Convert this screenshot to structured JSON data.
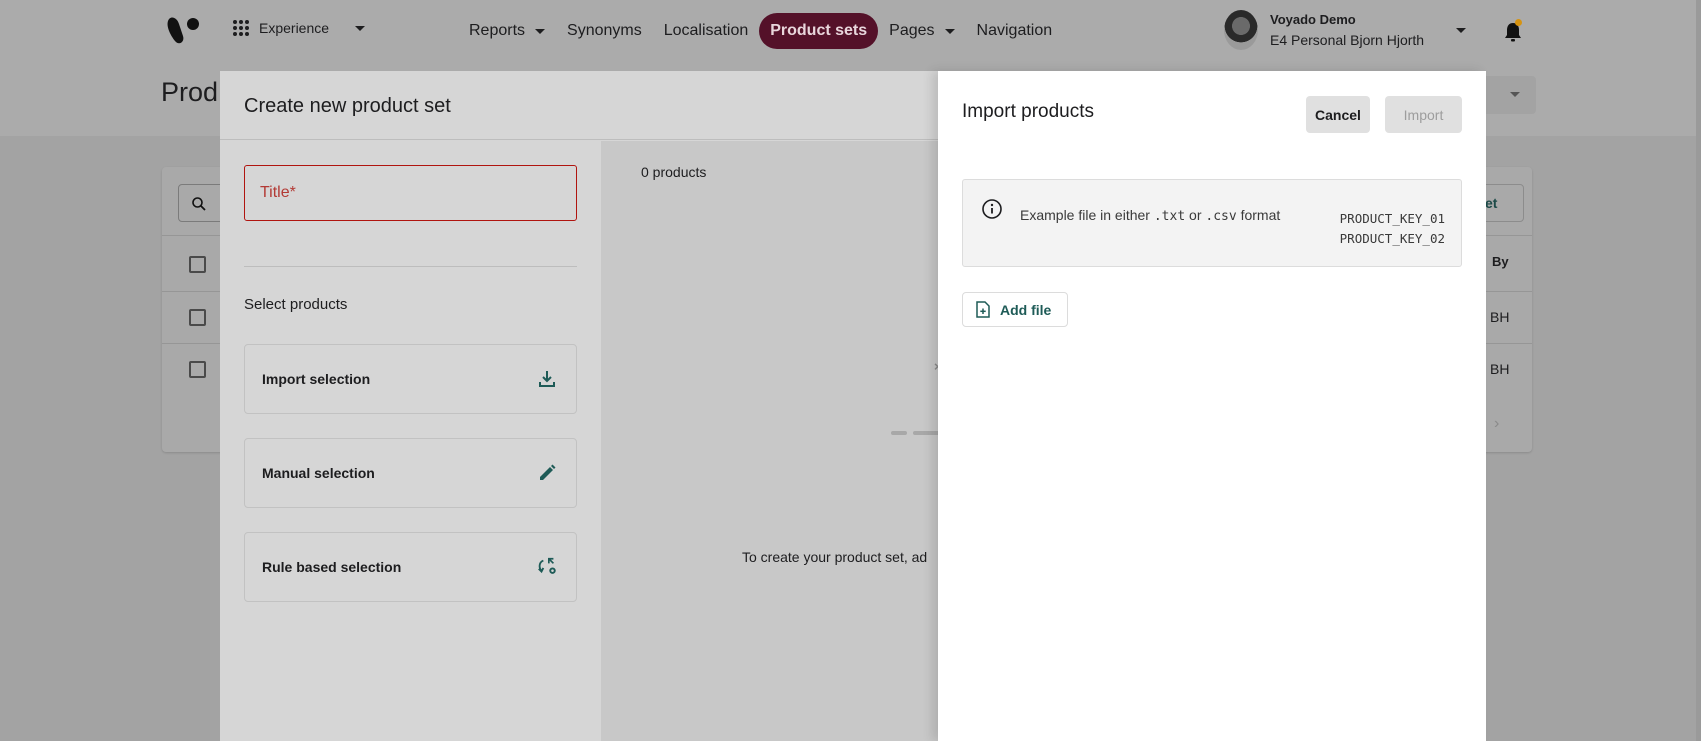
{
  "topbar": {
    "app_switch_label": "Experience",
    "nav": [
      {
        "label": "Reports",
        "has_dropdown": true,
        "active": false
      },
      {
        "label": "Synonyms",
        "has_dropdown": false,
        "active": false
      },
      {
        "label": "Localisation",
        "has_dropdown": false,
        "active": false
      },
      {
        "label": "Product sets",
        "has_dropdown": false,
        "active": true
      },
      {
        "label": "Pages",
        "has_dropdown": true,
        "active": false
      },
      {
        "label": "Navigation",
        "has_dropdown": false,
        "active": false
      }
    ],
    "user": {
      "name": "Voyado Demo",
      "account": "E4 Personal Bjorn Hjorth"
    },
    "notification_dot_color": "#d69310"
  },
  "background_page": {
    "title_visible": "Prod",
    "new_button_partial": "et",
    "column_by": "By",
    "rows": [
      {
        "by": "BH"
      },
      {
        "by": "BH"
      }
    ]
  },
  "create_sheet": {
    "title": "Create new product set",
    "title_field_placeholder": "Title*",
    "select_products_label": "Select products",
    "options": [
      {
        "label": "Import selection",
        "icon": "download-icon"
      },
      {
        "label": "Manual selection",
        "icon": "pencil-icon"
      },
      {
        "label": "Rule based selection",
        "icon": "rule-settings-icon"
      }
    ],
    "product_count": "0 products",
    "empty_state_text": "To create your product set, ad"
  },
  "import_panel": {
    "title": "Import products",
    "cancel_label": "Cancel",
    "import_label": "Import",
    "info": {
      "prefix": "Example file in either ",
      "ext1": ".txt",
      "middle": " or ",
      "ext2": ".csv",
      "suffix": " format",
      "example_keys": [
        "PRODUCT_KEY_01",
        "PRODUCT_KEY_02"
      ]
    },
    "add_file_label": "Add file"
  },
  "colors": {
    "brand_active": "#541129",
    "accent_teal": "#1e5b57",
    "error_red": "#b0140f"
  }
}
